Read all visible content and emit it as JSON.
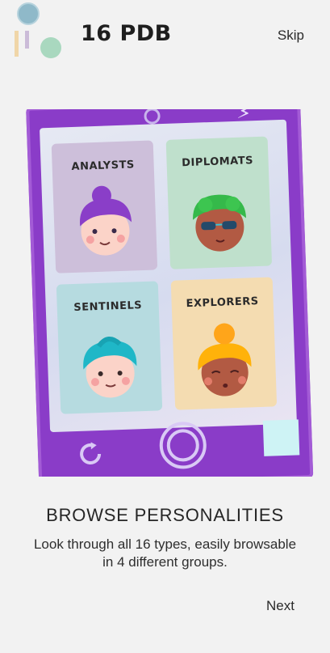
{
  "header": {
    "app_title": "16 PDB",
    "skip_label": "Skip"
  },
  "illustration": {
    "cards": [
      {
        "label": "ANALYSTS",
        "color": "#cdbfda"
      },
      {
        "label": "DIPLOMATS",
        "color": "#bfe0cc"
      },
      {
        "label": "SENTINELS",
        "color": "#b6dbe0"
      },
      {
        "label": "EXPLORERS",
        "color": "#f4dcb1"
      }
    ],
    "phone_color": "#8a3cc8"
  },
  "onboarding": {
    "title": "BROWSE PERSONALITIES",
    "description": "Look through all 16 types, easily browsable in 4 different groups.",
    "next_label": "Next"
  }
}
